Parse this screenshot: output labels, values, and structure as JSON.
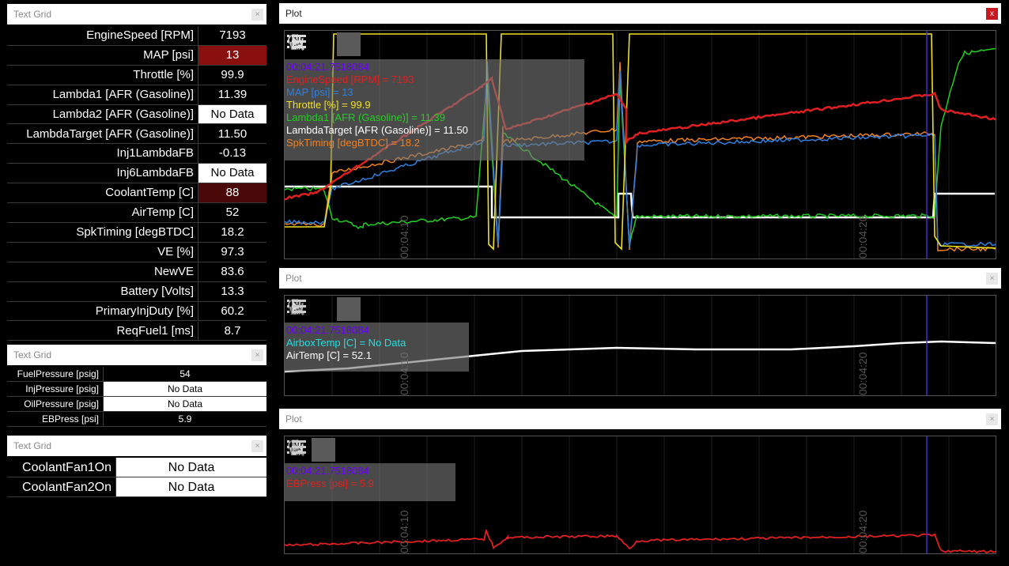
{
  "grid1": {
    "title": "Text Grid",
    "close": "×",
    "rows": [
      {
        "label": "EngineSpeed [RPM]",
        "value": "7193",
        "style": "dark"
      },
      {
        "label": "MAP [psi]",
        "value": "13",
        "style": "red"
      },
      {
        "label": "Throttle [%]",
        "value": "99.9",
        "style": "dark"
      },
      {
        "label": "Lambda1 [AFR (Gasoline)]",
        "value": "11.39",
        "style": "dark"
      },
      {
        "label": "Lambda2 [AFR (Gasoline)]",
        "value": "No Data",
        "style": "white"
      },
      {
        "label": "LambdaTarget [AFR (Gasoline)]",
        "value": "11.50",
        "style": "dark"
      },
      {
        "label": "Inj1LambdaFB",
        "value": "-0.13",
        "style": "dark"
      },
      {
        "label": "Inj6LambdaFB",
        "value": "No Data",
        "style": "white"
      },
      {
        "label": "CoolantTemp [C]",
        "value": "88",
        "style": "maroon"
      },
      {
        "label": "AirTemp [C]",
        "value": "52",
        "style": "dark"
      },
      {
        "label": "SpkTiming [degBTDC]",
        "value": "18.2",
        "style": "dark"
      },
      {
        "label": "VE [%]",
        "value": "97.3",
        "style": "dark"
      },
      {
        "label": "NewVE",
        "value": "83.6",
        "style": "dark"
      },
      {
        "label": "Battery [Volts]",
        "value": "13.3",
        "style": "dark"
      },
      {
        "label": "PrimaryInjDuty [%]",
        "value": "60.2",
        "style": "dark"
      },
      {
        "label": "ReqFuel1 [ms]",
        "value": "8.7",
        "style": "dark"
      }
    ]
  },
  "grid2": {
    "title": "Text Grid",
    "close": "×",
    "rows": [
      {
        "label": "FuelPressure [psig]",
        "value": "54",
        "style": "dark"
      },
      {
        "label": "InjPressure [psig]",
        "value": "No Data",
        "style": "white"
      },
      {
        "label": "OilPressure [psig]",
        "value": "No Data",
        "style": "white"
      },
      {
        "label": "EBPress [psi]",
        "value": "5.9",
        "style": "dark"
      }
    ]
  },
  "grid3": {
    "title": "Text Grid",
    "close": "×",
    "rows": [
      {
        "label": "CoolantFan1On",
        "value": "No Data",
        "style": "white"
      },
      {
        "label": "CoolantFan2On",
        "value": "No Data",
        "style": "white"
      }
    ]
  },
  "plot1": {
    "title": "Plot",
    "close": "x",
    "time_labels": [
      "00:04:10",
      "00:04:20"
    ],
    "legend": [
      {
        "text": "00:04:21.7518084",
        "color": "#6a00ff"
      },
      {
        "text": "EngineSpeed [RPM] = 7193",
        "color": "#e02020"
      },
      {
        "text": "MAP [psi] = 13",
        "color": "#2f7fe0"
      },
      {
        "text": "Throttle [%] = 99.9",
        "color": "#f0e020"
      },
      {
        "text": "Lambda1 [AFR (Gasoline)] = 11.39",
        "color": "#20d020"
      },
      {
        "text": "LambdaTarget [AFR (Gasoline)] = 11.50",
        "color": "#ffffff"
      },
      {
        "text": "SpkTiming [degBTDC] = 18.2",
        "color": "#f08020"
      }
    ]
  },
  "plot2": {
    "title": "Plot",
    "close": "×",
    "time_labels": [
      "00:04:10",
      "00:04:20"
    ],
    "legend": [
      {
        "text": "00:04:21.7518084",
        "color": "#6a00ff"
      },
      {
        "text": "AirboxTemp [C] = No Data",
        "color": "#20e0e0"
      },
      {
        "text": "AirTemp [C] = 52.1",
        "color": "#ffffff"
      }
    ]
  },
  "plot3": {
    "title": "Plot",
    "close": "×",
    "time_labels": [
      "00:04:10",
      "00:04:20"
    ],
    "legend": [
      {
        "text": "00:04:21.7518084",
        "color": "#6a00ff"
      },
      {
        "text": "EBPress [psi] = 5.9",
        "color": "#e02020"
      }
    ]
  },
  "colors": {
    "rpm": "#e02020",
    "map": "#2f7fe0",
    "throttle": "#f0e020",
    "lambda": "#20d020",
    "target": "#ffffff",
    "spk": "#f08020",
    "airtemp": "#ffffff",
    "ebpress": "#e02020",
    "cursor": "#4b2bd0"
  },
  "icons": {
    "zoom": "magnifier-icon",
    "pan": "hand-icon",
    "select": "arrow-cursor-icon",
    "list": "list-icon"
  }
}
